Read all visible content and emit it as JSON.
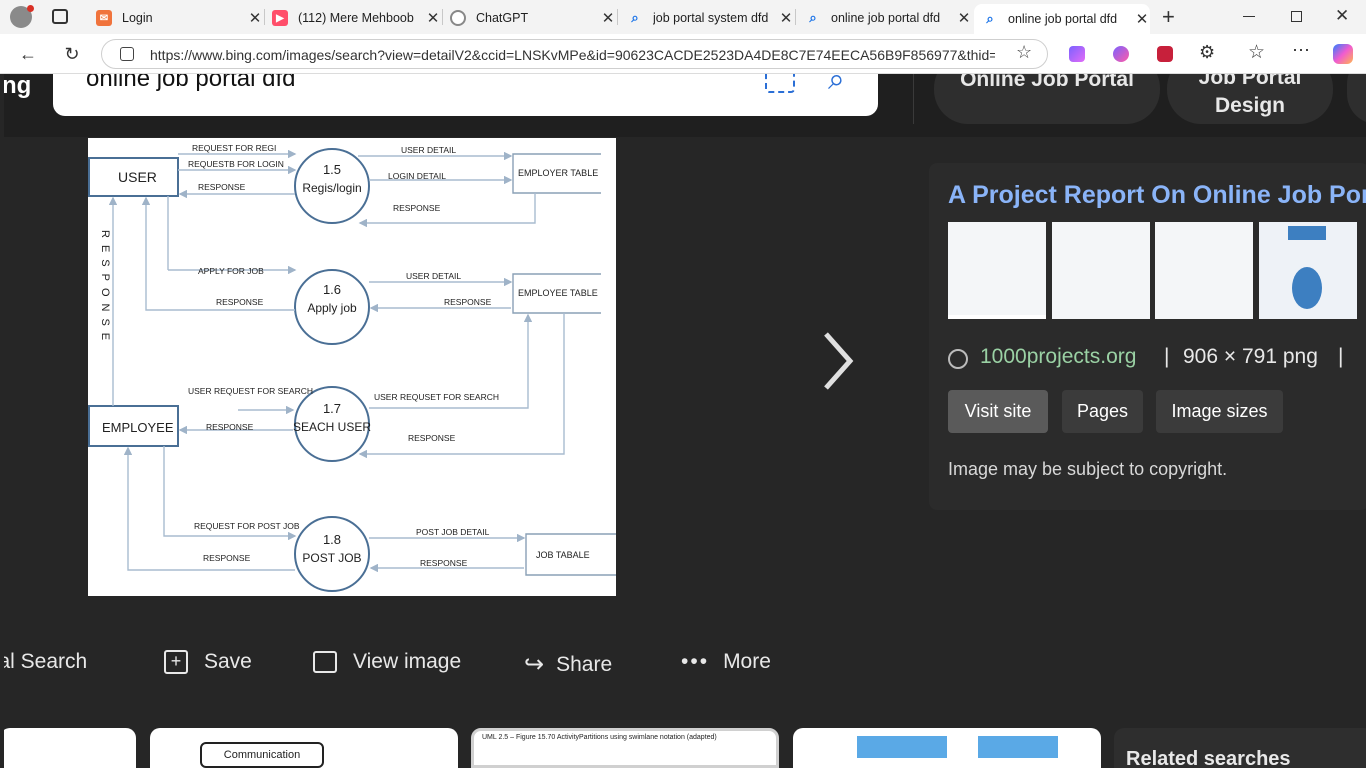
{
  "browser": {
    "tabs": [
      {
        "title": "Login",
        "favicon": "tool-icon",
        "color": "#f0733c"
      },
      {
        "title": "(112) Mere Mehboob",
        "favicon": "youtube-icon",
        "color": "#ff4e6a"
      },
      {
        "title": "ChatGPT",
        "favicon": "chatgpt-icon",
        "color": "#888888"
      },
      {
        "title": "job portal system dfd",
        "favicon": "search-icon",
        "color": "#1a73e8"
      },
      {
        "title": "online job portal dfd",
        "favicon": "search-icon",
        "color": "#1a73e8"
      },
      {
        "title": "online job portal dfd",
        "favicon": "search-icon",
        "color": "#1a73e8"
      }
    ],
    "url": "https://www.bing.com/images/search?view=detailV2&ccid=LNSKvMPe&id=90623CACDE2523DA4DE8C7E74EECA56B9F856977&thid=..."
  },
  "search": {
    "logo_fragment": "ng",
    "query": "online job portal dfd",
    "related_pills": [
      "Online Job Portal",
      "Job Portal Design"
    ]
  },
  "diagram": {
    "entities": [
      "USER",
      "EMPLOYEE",
      "EMPLOYER TABLE",
      "EMPLOYEE TABLE",
      "JOB TABALE"
    ],
    "processes": [
      {
        "num": "1.5",
        "name": "Regis/login"
      },
      {
        "num": "1.6",
        "name": "Apply job"
      },
      {
        "num": "1.7",
        "name": "SEACH USER"
      },
      {
        "num": "1.8",
        "name": "POST JOB"
      }
    ],
    "flows": [
      "REQUEST FOR REGI",
      "REQUESTB FOR LOGIN",
      "RESPONSE",
      "USER DETAIL",
      "LOGIN DETAIL",
      "APPLY FOR JOB",
      "USER REQUEST FOR SEARCH",
      "USER REQUSET FOR SEARCH",
      "REQUEST FOR POST JOB",
      "POST JOB DETAIL"
    ],
    "vertical_label": "RESPONSE"
  },
  "panel": {
    "title": "A Project Report On Online Job Portal",
    "source": "1000projects.org",
    "meta": "906 × 791 png",
    "buttons": [
      "Visit site",
      "Pages",
      "Image sizes"
    ],
    "copyright": "Image may be subject to copyright."
  },
  "actions": [
    "Visual Search",
    "Save",
    "View image",
    "Share",
    "More"
  ],
  "bottom": {
    "related": "Related searches",
    "card2_label": "Communication",
    "card3_caption": "UML 2.5 – Figure 15.70 ActivityPartitions using swimlane notation (adapted)"
  }
}
